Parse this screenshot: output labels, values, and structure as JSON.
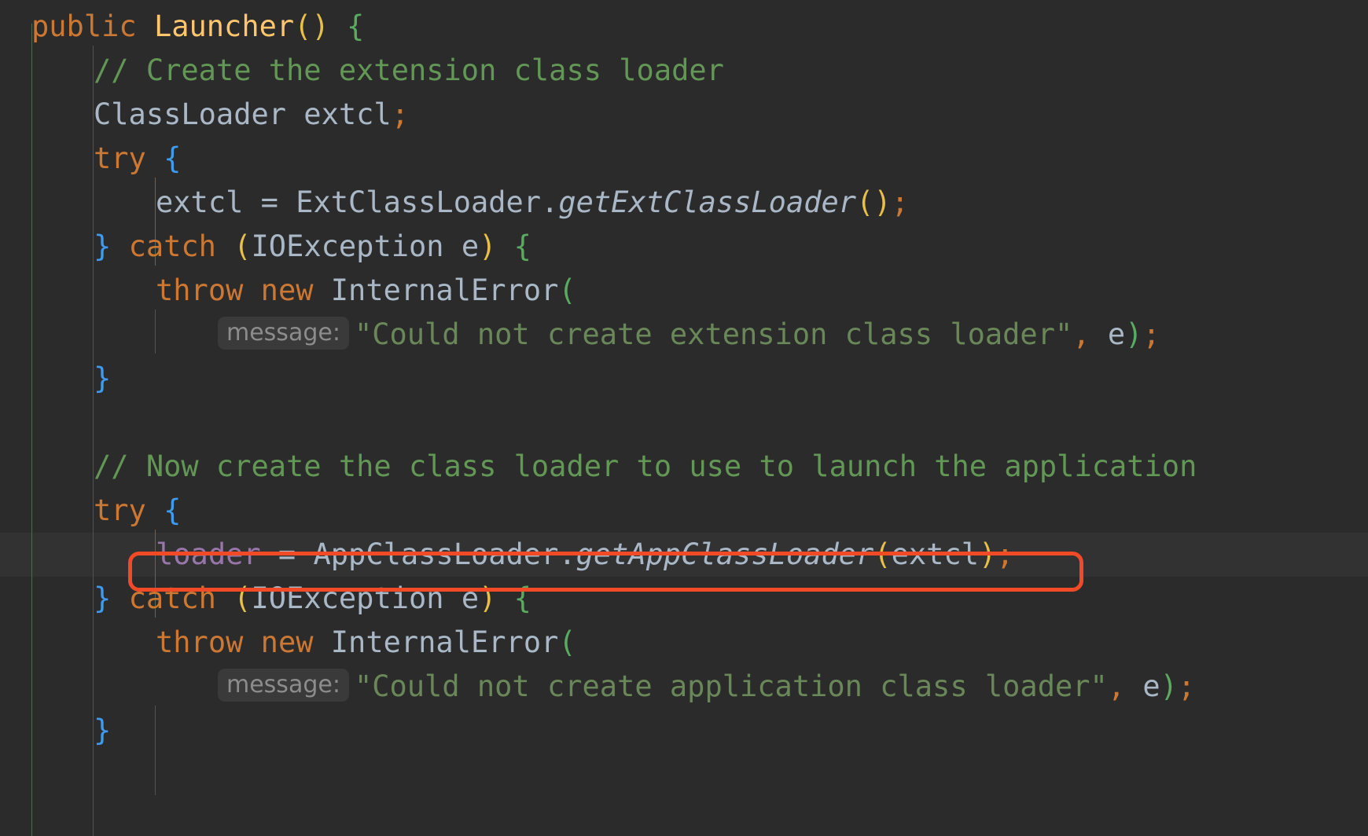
{
  "editor": {
    "language": "Java",
    "theme": "Darcula",
    "background_color": "#2b2b2b",
    "current_line_color": "#323232"
  },
  "colors": {
    "keyword": "#cc7832",
    "comment": "#629755",
    "string": "#6a8759",
    "identifier": "#a9b7c6",
    "field": "#9876aa",
    "class_name": "#ffc66d",
    "bracket_green": "#5aab61",
    "bracket_yellow": "#e8bf49",
    "bracket_blue": "#3d9bf0",
    "inlay_hint_text": "#8c8c8c",
    "inlay_hint_background": "#3a3a3a",
    "annotation_border": "#f04a27",
    "scope_guide_green": "#4d6b4d",
    "indent_guide": "#4f5254",
    "indent_guide_active": "#4a6a8a"
  },
  "annotation": {
    "type": "rectangle-highlight",
    "color": "#f04a27",
    "target_line_index": 11
  },
  "code_lines": [
    {
      "index": 0,
      "indent": 0,
      "tokens": [
        {
          "text": "public",
          "kind": "keyword"
        },
        {
          "text": " ",
          "kind": "plain"
        },
        {
          "text": "Launcher",
          "kind": "class_name"
        },
        {
          "text": "(",
          "kind": "bracket_yellow"
        },
        {
          "text": ")",
          "kind": "bracket_yellow"
        },
        {
          "text": " ",
          "kind": "plain"
        },
        {
          "text": "{",
          "kind": "bracket_green"
        }
      ]
    },
    {
      "index": 1,
      "indent": 1,
      "tokens": [
        {
          "text": "// Create the extension class loader",
          "kind": "comment"
        }
      ]
    },
    {
      "index": 2,
      "indent": 1,
      "tokens": [
        {
          "text": "ClassLoader extcl",
          "kind": "identifier"
        },
        {
          "text": ";",
          "kind": "keyword"
        }
      ]
    },
    {
      "index": 3,
      "indent": 1,
      "tokens": [
        {
          "text": "try",
          "kind": "keyword"
        },
        {
          "text": " ",
          "kind": "plain"
        },
        {
          "text": "{",
          "kind": "bracket_blue"
        }
      ]
    },
    {
      "index": 4,
      "indent": 2,
      "tokens": [
        {
          "text": "extcl = ExtClassLoader.",
          "kind": "identifier"
        },
        {
          "text": "getExtClassLoader",
          "kind": "method"
        },
        {
          "text": "(",
          "kind": "bracket_yellow"
        },
        {
          "text": ")",
          "kind": "bracket_yellow"
        },
        {
          "text": ";",
          "kind": "keyword"
        }
      ]
    },
    {
      "index": 5,
      "indent": 1,
      "tokens": [
        {
          "text": "}",
          "kind": "bracket_blue"
        },
        {
          "text": " ",
          "kind": "plain"
        },
        {
          "text": "catch",
          "kind": "keyword"
        },
        {
          "text": " ",
          "kind": "plain"
        },
        {
          "text": "(",
          "kind": "bracket_yellow"
        },
        {
          "text": "IOException e",
          "kind": "identifier"
        },
        {
          "text": ")",
          "kind": "bracket_yellow"
        },
        {
          "text": " ",
          "kind": "plain"
        },
        {
          "text": "{",
          "kind": "bracket_green"
        }
      ]
    },
    {
      "index": 6,
      "indent": 2,
      "tokens": [
        {
          "text": "throw",
          "kind": "keyword"
        },
        {
          "text": " ",
          "kind": "plain"
        },
        {
          "text": "new",
          "kind": "keyword"
        },
        {
          "text": " ",
          "kind": "plain"
        },
        {
          "text": "InternalError",
          "kind": "identifier"
        },
        {
          "text": "(",
          "kind": "bracket_green"
        }
      ]
    },
    {
      "index": 7,
      "indent": 3,
      "hint": "message:",
      "tokens": [
        {
          "text": "\"Could not create extension class loader\"",
          "kind": "string"
        },
        {
          "text": ",",
          "kind": "keyword"
        },
        {
          "text": " ",
          "kind": "plain"
        },
        {
          "text": "e",
          "kind": "identifier"
        },
        {
          "text": ")",
          "kind": "bracket_green"
        },
        {
          "text": ";",
          "kind": "keyword"
        }
      ]
    },
    {
      "index": 8,
      "indent": 1,
      "tokens": [
        {
          "text": "}",
          "kind": "bracket_blue"
        }
      ]
    },
    {
      "index": 9,
      "indent": 0,
      "tokens": []
    },
    {
      "index": 10,
      "indent": 1,
      "tokens": [
        {
          "text": "// Now create the class loader to use to launch the application",
          "kind": "comment"
        }
      ]
    },
    {
      "index": 11,
      "indent": 1,
      "tokens": [
        {
          "text": "try",
          "kind": "keyword"
        },
        {
          "text": " ",
          "kind": "plain"
        },
        {
          "text": "{",
          "kind": "bracket_blue"
        }
      ]
    },
    {
      "index": 12,
      "indent": 2,
      "highlighted": true,
      "annotated": true,
      "tokens": [
        {
          "text": "loader",
          "kind": "field"
        },
        {
          "text": " = AppClassLoader.",
          "kind": "identifier"
        },
        {
          "text": "getAppClassLoader",
          "kind": "method"
        },
        {
          "text": "(",
          "kind": "bracket_yellow"
        },
        {
          "text": "extcl",
          "kind": "identifier"
        },
        {
          "text": ")",
          "kind": "bracket_yellow"
        },
        {
          "text": ";",
          "kind": "keyword"
        }
      ]
    },
    {
      "index": 13,
      "indent": 1,
      "tokens": [
        {
          "text": "}",
          "kind": "bracket_blue"
        },
        {
          "text": " ",
          "kind": "plain"
        },
        {
          "text": "catch",
          "kind": "keyword"
        },
        {
          "text": " ",
          "kind": "plain"
        },
        {
          "text": "(",
          "kind": "bracket_yellow"
        },
        {
          "text": "IOException e",
          "kind": "identifier"
        },
        {
          "text": ")",
          "kind": "bracket_yellow"
        },
        {
          "text": " ",
          "kind": "plain"
        },
        {
          "text": "{",
          "kind": "bracket_green"
        }
      ]
    },
    {
      "index": 14,
      "indent": 2,
      "tokens": [
        {
          "text": "throw",
          "kind": "keyword"
        },
        {
          "text": " ",
          "kind": "plain"
        },
        {
          "text": "new",
          "kind": "keyword"
        },
        {
          "text": " ",
          "kind": "plain"
        },
        {
          "text": "InternalError",
          "kind": "identifier"
        },
        {
          "text": "(",
          "kind": "bracket_green"
        }
      ]
    },
    {
      "index": 15,
      "indent": 3,
      "hint": "message:",
      "tokens": [
        {
          "text": "\"Could not create application class loader\"",
          "kind": "string"
        },
        {
          "text": ",",
          "kind": "keyword"
        },
        {
          "text": " ",
          "kind": "plain"
        },
        {
          "text": "e",
          "kind": "identifier"
        },
        {
          "text": ")",
          "kind": "bracket_green"
        },
        {
          "text": ";",
          "kind": "keyword"
        }
      ]
    },
    {
      "index": 16,
      "indent": 1,
      "tokens": [
        {
          "text": "}",
          "kind": "bracket_blue"
        }
      ]
    }
  ]
}
